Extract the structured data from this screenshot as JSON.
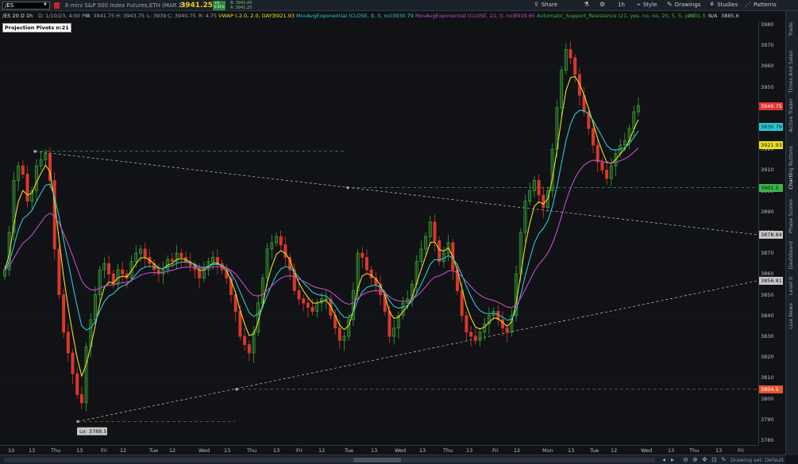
{
  "toolbar": {
    "symbol": "/ES",
    "description": "E-mini S&P 500 Index Futures,ETH (MAR 23)",
    "last_price": "3941.25",
    "change_top": "+0",
    "change_bottom": "0.01%",
    "bid": "B: 3941.00",
    "ask": "A: 3941.25",
    "share_label": "Share",
    "aggregation_label": "1h",
    "style_label": "Style",
    "drawings_label": "Drawings",
    "studies_label": "Studies",
    "patterns_label": "Patterns",
    "icons": [
      "share-icon",
      "beaker-icon",
      "gear-icon",
      "style-icon",
      "pencil-icon",
      "studies-icon",
      "patterns-icon"
    ]
  },
  "infoline": {
    "chart_id": "/ES 20 D 1h",
    "date": "D: 1/10/23, 4:00 PM",
    "open": "O: 3941.75",
    "high": "H: 3943.75",
    "low": "L: 3939",
    "close": "C: 3940.75",
    "range": "R: 4.75",
    "vwap": "VWAP (-2.0, 2.0, DAY)",
    "vwap_value": "3921.93",
    "ema9": "MovAvgExponential (CLOSE, 9, 0, no)",
    "ema9_value": "3930.79",
    "ema21": "MovAvgExponential (CLOSE, 21, 0, no)",
    "ema21_value": "3919.65",
    "asr": "Automatic_Support_Resistance (21, yes, no, no, 20, 5, 5, yes)",
    "asr_v1": "3901.5",
    "asr_v2": "N/A",
    "asr_v3": "3885.6"
  },
  "chart_labels": {
    "pivots": "Projection Pivots n:21",
    "low_label": "Lo: 3788.5"
  },
  "price_axis": {
    "ticks": [
      "3980",
      "3970",
      "3960",
      "3950",
      "3940",
      "3930",
      "3920",
      "3910",
      "3900",
      "3890",
      "3880",
      "3870",
      "3860",
      "3850",
      "3840",
      "3830",
      "3820",
      "3810",
      "3800",
      "3790",
      "3780"
    ],
    "badges": [
      {
        "text": "3940.75",
        "bg": "#e3342f",
        "fg": "#ffffff",
        "price": 3940.75
      },
      {
        "text": "3930.79",
        "bg": "#2fc6d6",
        "fg": "#002020",
        "price": 3930.79
      },
      {
        "text": "3921.93",
        "bg": "#e8e025",
        "fg": "#202000",
        "price": 3921.93
      },
      {
        "text": "3901.5",
        "bg": "#3bb54a",
        "fg": "#001a00",
        "price": 3901.5
      },
      {
        "text": "3878.84",
        "bg": "#c8c8c8",
        "fg": "#101010",
        "price": 3878.84
      },
      {
        "text": "3856.81",
        "bg": "#c8c8c8",
        "fg": "#101010",
        "price": 3856.81
      },
      {
        "text": "3804.5",
        "bg": "#e8542f",
        "fg": "#ffffff",
        "price": 3804.5
      }
    ]
  },
  "time_axis": {
    "ticks": [
      "10",
      "13",
      "Thu",
      "13",
      "Fri",
      "12",
      "Tue",
      "12",
      "Wed",
      "13",
      "Thu",
      "13",
      "Fri",
      "12",
      "Tue",
      "13",
      "Wed",
      "13",
      "Thu",
      "13",
      "Fri",
      "12",
      "Mon",
      "13",
      "Tue",
      "12",
      "Wed",
      "13",
      "Thu",
      "13",
      "Fri"
    ]
  },
  "side_tabs": [
    "Trade",
    "Times And Sales",
    "Active Trader",
    "Big Buttons",
    "Chart",
    "Phase Scores",
    "Dashboard",
    "Level II",
    "Live News"
  ],
  "bottom": {
    "drawing_set": "Drawing set: Default"
  },
  "colors": {
    "up": "#3aa335",
    "down": "#d8382b",
    "ema9": "#2fc6d6",
    "vwap": "#e8e025",
    "ema21": "#c04ec8",
    "support": "#3bb54a",
    "resistance": "#d84b3b",
    "trend": "#c8c8c8"
  }
}
